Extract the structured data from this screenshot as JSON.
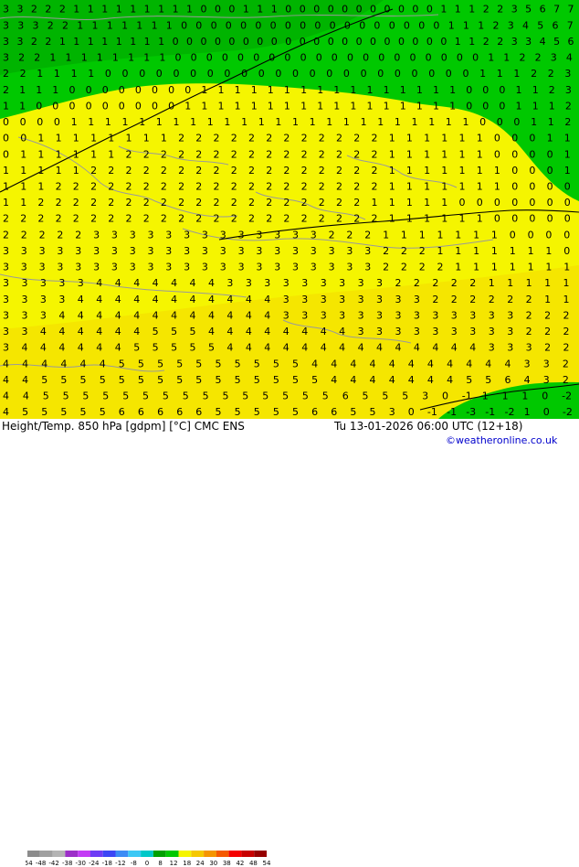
{
  "footer": {
    "title": "Height/Temp. 850 hPa [gdpm] [°C] CMC ENS",
    "datetime": "Tu 13-01-2026 06:00 UTC (12+18)",
    "credit": "©weatheronline.co.uk"
  },
  "colorbar": {
    "ticks": [
      "-54",
      "-48",
      "-42",
      "-38",
      "-30",
      "-24",
      "-18",
      "-12",
      "-8",
      "0",
      "8",
      "12",
      "18",
      "24",
      "30",
      "38",
      "42",
      "48",
      "54"
    ],
    "colors": [
      "#8c8c8c",
      "#a0a0a0",
      "#b4b4b4",
      "#9c2fc8",
      "#c33cf5",
      "#6e3cf5",
      "#3c46f5",
      "#3c8cf5",
      "#3cc8f5",
      "#00c8c8",
      "#00a000",
      "#00c800",
      "#f5f500",
      "#f5c800",
      "#f59600",
      "#f55a00",
      "#f50000",
      "#c80000",
      "#960000"
    ],
    "colors_meaning": "color scale used in map"
  },
  "map": {
    "colors": {
      "green_dark": "#00b400",
      "green": "#00c800",
      "yellow": "#f5f500",
      "yellow_orange": "#f5e100",
      "contour": "#000000",
      "coast": "#a0a0a0",
      "label_text": "#000000"
    },
    "rows": [
      "3 3 2 2 2 1 1 1 1 1 1 1 1 1 0 0 0 1 1 1 0 0 0 0 0 0 0 0 0 0 0 1 1 1 2 2 3 5 6 7 7",
      "3 3 3 2 2 1 1 1 1 1 1 1 0 0 0 0 0 0 0 0 0 0 0 0 0 0 0 0 0 0 1 1 1 2 3 4 5 6 7",
      "3 3 2 2 1 1 1 1 1 1 1 1 0 0 0 0 0 0 0 0 0 0 0 0 0 0 0 0 0 0 0 0 1 1 2 2 3 3 4 5 6",
      "3 2 2 1 1 1 1 1 1 1 1 0 0 0 0 0 0 0 0 0 0 0 0 0 0 0 0 0 0 0 0 1 1 2 2 3 4",
      "2 2 1 1 1 1 0 0 0 0 0 0 0 0 0 0 0 0 0 0 0 0 0 0 0 0 0 0 1 1 1 2 2 3",
      "2 1 1 1 0 0 0 0 0 0 0 0 1 1 1 1 1 1 1 1 1 1 1 1 1 1 1 1 0 0 0 1 1 2 3",
      "1 1 0 0 0 0 0 0 0 0 0 1 1 1 1 1 1 1 1 1 1 1 1 1 1 1 1 1 0 0 0 1 1 1 2",
      "0 0 0 0 1 1 1 1 1 1 1 1 1 1 1 1 1 1 1 1 1 1 1 1 1 1 1 1 0 0 0 1 1 2",
      "0 0 1 1 1 1 1 1 1 1 2 2 2 2 2 2 2 2 2 2 2 2 1 1 1 1 1 1 0 0 0 1 1",
      "0 1 1 1 1 1 1 2 2 2 2 2 2 2 2 2 2 2 2 2 2 2 1 1 1 1 1 1 0 0 0 0 1",
      "1 1 1 1 1 2 2 2 2 2 2 2 2 2 2 2 2 2 2 2 2 2 1 1 1 1 1 1 1 0 0 0 1",
      "1 1 1 2 2 2 2 2 2 2 2 2 2 2 2 2 2 2 2 2 2 2 1 1 1 1 1 1 1 0 0 0 0",
      "1 1 2 2 2 2 2 2 2 2 2 2 2 2 2 2 2 2 2 2 2 1 1 1 1 1 0 0 0 0 0 0 0",
      "2 2 2 2 2 2 2 2 2 2 2 2 2 2 2 2 2 2 2 2 2 2 1 1 1 1 1 1 0 0 0 0 0",
      "2 2 2 2 2 3 3 3 3 3 3 3 3 3 3 3 3 3 2 2 2 1 1 1 1 1 1 1 0 0 0 0",
      "3 3 3 3 3 3 3 3 3 3 3 3 3 3 3 3 3 3 3 3 3 2 2 2 1 1 1 1 1 1 1 0",
      "3 3 3 3 3 3 3 3 3 3 3 3 3 3 3 3 3 3 3 3 3 2 2 2 2 1 1 1 1 1 1 1",
      "3 3 3 3 3 4 4 4 4 4 4 4 3 3 3 3 3 3 3 3 3 2 2 2 2 2 1 1 1 1 1",
      "3 3 3 3 4 4 4 4 4 4 4 4 4 4 4 3 3 3 3 3 3 3 3 2 2 2 2 2 2 1 1",
      "3 3 3 4 4 4 4 4 4 4 4 4 4 4 4 3 3 3 3 3 3 3 3 3 3 3 3 3 2 2 2",
      "3 3 4 4 4 4 4 4 5 5 5 4 4 4 4 4 4 4 4 3 3 3 3 3 3 3 3 3 2 2 2",
      "3 4 4 4 4 4 4 5 5 5 5 5 4 4 4 4 4 4 4 4 4 4 4 4 4 4 3 3 3 2 2",
      "4 4 4 4 4 4 5 5 5 5 5 5 5 5 5 5 4 4 4 4 4 4 4 4 4 4 4 3 3 2",
      "4 4 5 5 5 5 5 5 5 5 5 5 5 5 5 5 5 4 4 4 4 4 4 4 5 5 6 4 3 2",
      "4 4 5 5 5 5 5 5 5 5 5 5 5 5 5 5 5 6 5 5 5 3 0 -1 1 1 1 0 -2",
      "4 5 5 5 5 5 6 6 6 6 6 5 5 5 5 5 6 6 5 5 3 0 -1 -1 -3 -1 -2 1 0 -2"
    ],
    "contour_label": "0"
  }
}
